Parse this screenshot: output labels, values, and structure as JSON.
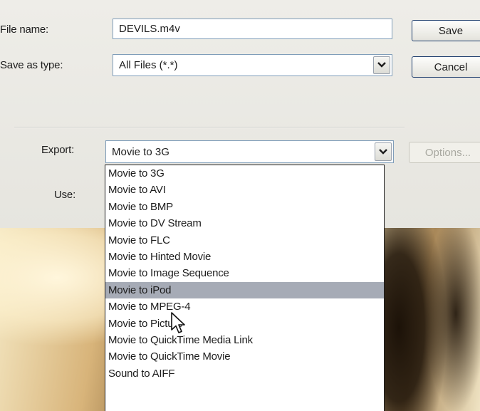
{
  "file_name": {
    "label": "File name:",
    "value": "DEVILS.m4v"
  },
  "save_as_type": {
    "label": "Save as type:",
    "value": "All Files (*.*)"
  },
  "buttons": {
    "save": "Save",
    "cancel": "Cancel",
    "options": "Options..."
  },
  "export": {
    "label": "Export:",
    "value": "Movie to 3G"
  },
  "use": {
    "label": "Use:"
  },
  "dropdown": {
    "highlighted_index": 8,
    "options": [
      "Movie to 3G",
      "Movie to AVI",
      "Movie to BMP",
      "Movie to DV Stream",
      "Movie to FLC",
      "Movie to Hinted Movie",
      "Movie to Image Sequence",
      "Movie to iPod",
      "Movie to MPEG-4",
      "Movie to Picture",
      "Movie to QuickTime Media Link",
      "Movie to QuickTime Movie",
      "Sound to AIFF"
    ]
  },
  "colors": {
    "highlight": "#a6abb6",
    "button_border": "#1f3f6e",
    "field_border": "#7f9db9"
  },
  "icons": {
    "combo_arrow": "chevron-down-icon",
    "cursor": "arrow-cursor-icon"
  }
}
